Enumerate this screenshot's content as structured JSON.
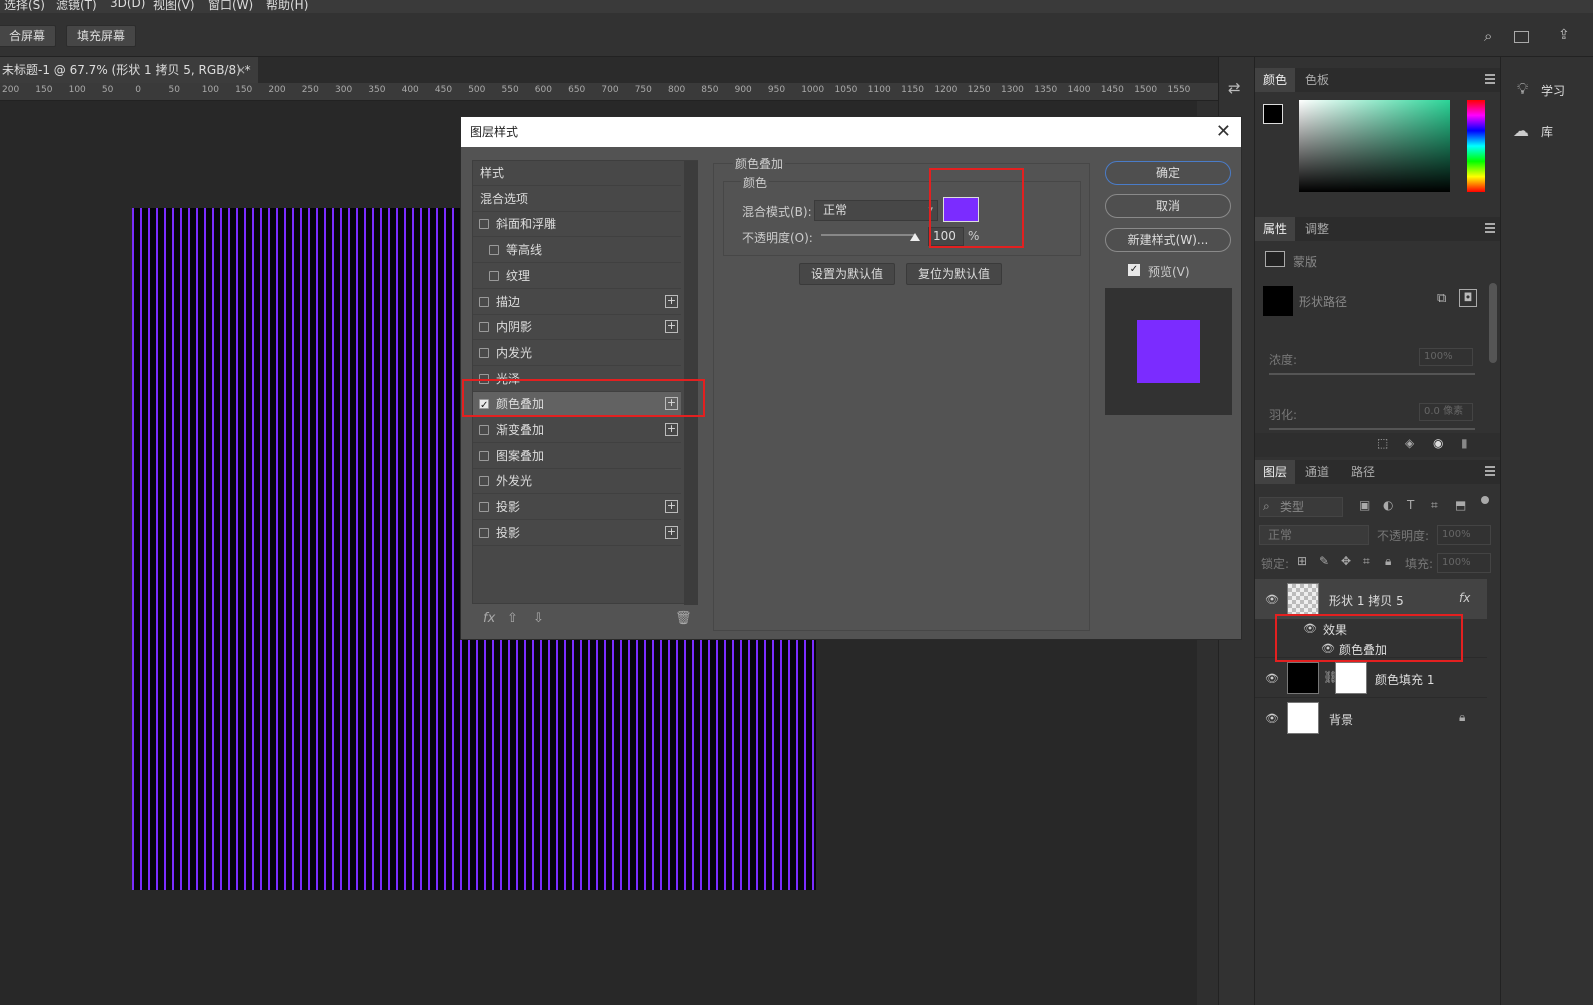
{
  "menubar": [
    "选择(S)",
    "滤镜(T)",
    "3D(D)",
    "视图(V)",
    "窗口(W)",
    "帮助(H)"
  ],
  "optbar": {
    "btn1": "合屏幕",
    "btn2": "填充屏幕"
  },
  "doc_tab": {
    "title": "未标题-1 @ 67.7% (形状 1 拷贝 5, RGB/8) *",
    "close": "×"
  },
  "ruler": [
    "200",
    "150",
    "100",
    "50",
    "0",
    "50",
    "100",
    "150",
    "200",
    "250",
    "300",
    "350",
    "400",
    "450",
    "500",
    "550",
    "600",
    "650",
    "700",
    "750",
    "800",
    "850",
    "900",
    "950",
    "1000",
    "1050",
    "1100",
    "1150",
    "1200",
    "1250",
    "1300",
    "1350",
    "1400",
    "1450",
    "1500",
    "1550"
  ],
  "dialog": {
    "title": "图层样式",
    "close": "✕",
    "styles": [
      {
        "label": "样式",
        "cb": false,
        "plus": false,
        "hascb": false,
        "indent": false
      },
      {
        "label": "混合选项",
        "cb": false,
        "plus": false,
        "hascb": false,
        "indent": false
      },
      {
        "label": "斜面和浮雕",
        "cb": false,
        "plus": false,
        "hascb": true,
        "indent": false
      },
      {
        "label": "等高线",
        "cb": false,
        "plus": false,
        "hascb": true,
        "indent": true
      },
      {
        "label": "纹理",
        "cb": false,
        "plus": false,
        "hascb": true,
        "indent": true
      },
      {
        "label": "描边",
        "cb": false,
        "plus": true,
        "hascb": true,
        "indent": false
      },
      {
        "label": "内阴影",
        "cb": false,
        "plus": true,
        "hascb": true,
        "indent": false
      },
      {
        "label": "内发光",
        "cb": false,
        "plus": false,
        "hascb": true,
        "indent": false
      },
      {
        "label": "光泽",
        "cb": false,
        "plus": false,
        "hascb": true,
        "indent": false
      },
      {
        "label": "颜色叠加",
        "cb": true,
        "plus": true,
        "hascb": true,
        "indent": false,
        "selected": true
      },
      {
        "label": "渐变叠加",
        "cb": false,
        "plus": true,
        "hascb": true,
        "indent": false
      },
      {
        "label": "图案叠加",
        "cb": false,
        "plus": false,
        "hascb": true,
        "indent": false
      },
      {
        "label": "外发光",
        "cb": false,
        "plus": false,
        "hascb": true,
        "indent": false
      },
      {
        "label": "投影",
        "cb": false,
        "plus": true,
        "hascb": true,
        "indent": false
      },
      {
        "label": "投影",
        "cb": false,
        "plus": true,
        "hascb": true,
        "indent": false
      }
    ],
    "fx": "fx",
    "section_title": "颜色叠加",
    "sub_title": "颜色",
    "blend_label": "混合模式(B):",
    "blend_value": "正常",
    "opacity_label": "不透明度(O):",
    "opacity_value": "100",
    "opacity_unit": "%",
    "opacity_level": 1.0,
    "overlay_color": "#7b2cff",
    "set_default": "设置为默认值",
    "reset_default": "复位为默认值",
    "ok": "确定",
    "cancel": "取消",
    "new_style": "新建样式(W)...",
    "preview": "预览(V)"
  },
  "color_panel": {
    "tab_color": "颜色",
    "tab_swatches": "色板"
  },
  "properties_panel": {
    "tab_props": "属性",
    "tab_adjust": "调整",
    "mask_label": "蒙版",
    "shape_path": "形状路径",
    "density_label": "浓度:",
    "density_value": "100%",
    "feather_label": "羽化:",
    "feather_value": "0.0 像素"
  },
  "layers_panel": {
    "tab_layers": "图层",
    "tab_channels": "通道",
    "tab_paths": "路径",
    "filter": "类型",
    "blend": "正常",
    "opacity_label": "不透明度:",
    "opacity_value": "100%",
    "lock_label": "锁定:",
    "fill_label": "填充:",
    "fill_value": "100%",
    "layers": [
      {
        "name": "形状 1 拷贝 5",
        "fx": "fx"
      },
      {
        "name": "效果"
      },
      {
        "name": "颜色叠加"
      },
      {
        "name": "颜色填充 1"
      },
      {
        "name": "背景"
      }
    ]
  },
  "learn": {
    "learn": "学习",
    "library": "库"
  }
}
